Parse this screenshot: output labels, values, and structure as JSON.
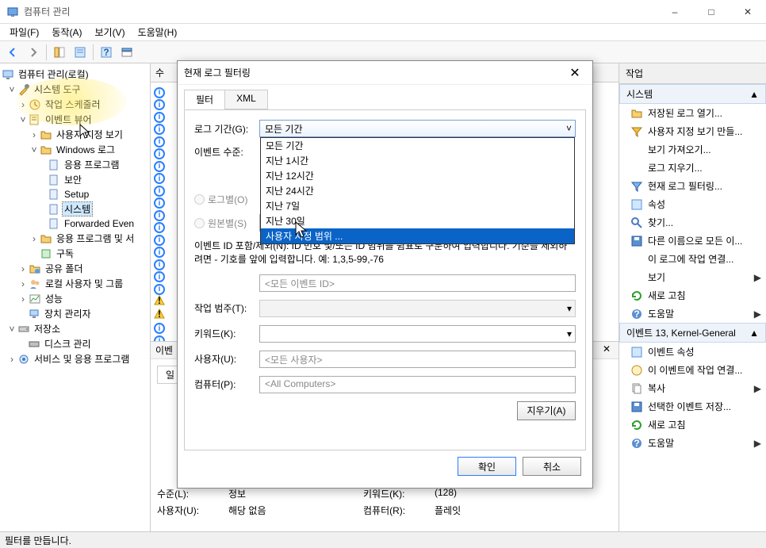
{
  "window": {
    "title": "컴퓨터 관리"
  },
  "menu": {
    "file": "파일(F)",
    "action": "동작(A)",
    "view": "보기(V)",
    "help": "도움말(H)"
  },
  "tree": {
    "root": "컴퓨터 관리(로컬)",
    "sys_tools": "시스템 도구",
    "task_sched": "작업 스케줄러",
    "event_viewer": "이벤트 뷰어",
    "custom_views": "사용자 지정 보기",
    "windows_logs": "Windows 로그",
    "app": "응용 프로그램",
    "security": "보안",
    "setup": "Setup",
    "system": "시스템",
    "forwarded": "Forwarded Even",
    "app_services": "응용 프로그램 및 서",
    "subscribe": "구독",
    "shared": "공유 폴더",
    "local_users": "로컬 사용자 및 그룹",
    "perf": "성능",
    "devmgr": "장치 관리자",
    "storage": "저장소",
    "diskmgr": "디스크 관리",
    "services": "서비스 및 응용 프로그램"
  },
  "center": {
    "header": "수",
    "event_header": "이벤",
    "tab_general": "일"
  },
  "modal": {
    "title": "현재 로그 필터링",
    "tab_filter": "필터",
    "tab_xml": "XML",
    "log_period_lbl": "로그 기간(G):",
    "log_period_value": "모든 기간",
    "dropdown_options": [
      "모든 기간",
      "지난 1시간",
      "지난 12시간",
      "지난 24시간",
      "지난 7일",
      "지난 30일",
      "사용자 지정 범위 ..."
    ],
    "event_level_lbl": "이벤트 수준:",
    "radio_loglevel": "로그별(O)",
    "radio_source": "원본별(S)",
    "note": "이벤트 ID 포함/제외(N): ID 번호 및/또는 ID 범위를 쉼표로 구분하여 입력합니다. 기준을 제외하려면 - 기호를 앞에 입력합니다. 예: 1,3,5-99,-76",
    "all_event_ids": "<모든 이벤트 ID>",
    "task_cat_lbl": "작업 범주(T):",
    "keyword_lbl": "키워드(K):",
    "user_lbl": "사용자(U):",
    "all_users": "<모든 사용자>",
    "computer_lbl": "컴퓨터(P):",
    "all_computers": "<All Computers>",
    "clear_btn": "지우기(A)",
    "ok": "확인",
    "cancel": "취소"
  },
  "actions": {
    "header": "작업",
    "section1": "시스템",
    "open_saved": "저장된 로그 열기...",
    "create_view": "사용자 지정 보기 만들...",
    "import_view": "보기 가져오기...",
    "clear_log": "로그 지우기...",
    "filter_log": "현재 로그 필터링...",
    "properties": "속성",
    "find": "찾기...",
    "save_as": "다른 이름으로 모든 이...",
    "attach_task": "이 로그에 작업 연결...",
    "view": "보기",
    "refresh": "새로 고침",
    "help": "도움말",
    "section2": "이벤트 13, Kernel-General",
    "event_props": "이벤트 속성",
    "attach_event_task": "이 이벤트에 작업 연결...",
    "copy": "복사",
    "save_selected": "선택한 이벤트 저장...",
    "refresh2": "새로 고침",
    "help2": "도움말"
  },
  "detail": {
    "level_lbl": "수준(L):",
    "level": "정보",
    "keyword_lbl": "키워드(K):",
    "keyword": "(128)",
    "user_lbl": "사용자(U):",
    "user": "해당 없음",
    "computer_lbl": "컴퓨터(R):",
    "computer": "플레잇"
  },
  "status": {
    "text": "필터를 만듭니다."
  }
}
